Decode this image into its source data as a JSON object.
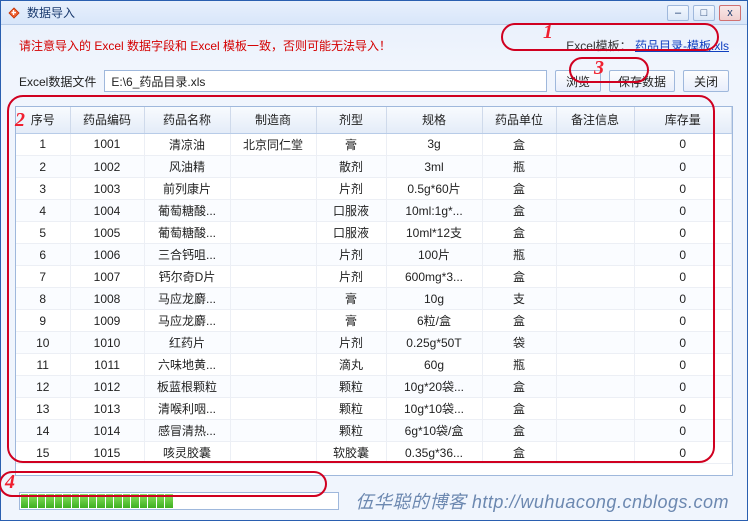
{
  "window": {
    "title": "数据导入"
  },
  "warning": "请注意导入的 Excel 数据字段和 Excel 模板一致，否则可能无法导入！",
  "template": {
    "label": "Excel模板：",
    "link_text": "药品目录-模板.xls"
  },
  "file": {
    "label": "Excel数据文件",
    "value": "E:\\6_药品目录.xls",
    "browse_label": "浏览",
    "save_label": "保存数据",
    "close_label": "关闭"
  },
  "columns": [
    "序号",
    "药品编码",
    "药品名称",
    "制造商",
    "剂型",
    "规格",
    "药品单位",
    "备注信息",
    "库存量"
  ],
  "rows": [
    {
      "seq": "1",
      "code": "1001",
      "name": "清凉油",
      "mfr": "北京同仁堂",
      "form": "膏",
      "spec": "3g",
      "unit": "盒",
      "remark": "",
      "stock": "0"
    },
    {
      "seq": "2",
      "code": "1002",
      "name": "风油精",
      "mfr": "",
      "form": "散剂",
      "spec": "3ml",
      "unit": "瓶",
      "remark": "",
      "stock": "0"
    },
    {
      "seq": "3",
      "code": "1003",
      "name": "前列康片",
      "mfr": "",
      "form": "片剂",
      "spec": "0.5g*60片",
      "unit": "盒",
      "remark": "",
      "stock": "0"
    },
    {
      "seq": "4",
      "code": "1004",
      "name": "葡萄糖酸...",
      "mfr": "",
      "form": "口服液",
      "spec": "10ml:1g*...",
      "unit": "盒",
      "remark": "",
      "stock": "0"
    },
    {
      "seq": "5",
      "code": "1005",
      "name": "葡萄糖酸...",
      "mfr": "",
      "form": "口服液",
      "spec": "10ml*12支",
      "unit": "盒",
      "remark": "",
      "stock": "0"
    },
    {
      "seq": "6",
      "code": "1006",
      "name": "三合钙咀...",
      "mfr": "",
      "form": "片剂",
      "spec": "100片",
      "unit": "瓶",
      "remark": "",
      "stock": "0"
    },
    {
      "seq": "7",
      "code": "1007",
      "name": "钙尔奇D片",
      "mfr": "",
      "form": "片剂",
      "spec": "600mg*3...",
      "unit": "盒",
      "remark": "",
      "stock": "0"
    },
    {
      "seq": "8",
      "code": "1008",
      "name": "马应龙麝...",
      "mfr": "",
      "form": "膏",
      "spec": "10g",
      "unit": "支",
      "remark": "",
      "stock": "0"
    },
    {
      "seq": "9",
      "code": "1009",
      "name": "马应龙麝...",
      "mfr": "",
      "form": "膏",
      "spec": "6粒/盒",
      "unit": "盒",
      "remark": "",
      "stock": "0"
    },
    {
      "seq": "10",
      "code": "1010",
      "name": "红药片",
      "mfr": "",
      "form": "片剂",
      "spec": "0.25g*50T",
      "unit": "袋",
      "remark": "",
      "stock": "0"
    },
    {
      "seq": "11",
      "code": "1011",
      "name": "六味地黄...",
      "mfr": "",
      "form": "滴丸",
      "spec": "60g",
      "unit": "瓶",
      "remark": "",
      "stock": "0"
    },
    {
      "seq": "12",
      "code": "1012",
      "name": "板蓝根颗粒",
      "mfr": "",
      "form": "颗粒",
      "spec": "10g*20袋...",
      "unit": "盒",
      "remark": "",
      "stock": "0"
    },
    {
      "seq": "13",
      "code": "1013",
      "name": "清喉利咽...",
      "mfr": "",
      "form": "颗粒",
      "spec": "10g*10袋...",
      "unit": "盒",
      "remark": "",
      "stock": "0"
    },
    {
      "seq": "14",
      "code": "1014",
      "name": "感冒清热...",
      "mfr": "",
      "form": "颗粒",
      "spec": "6g*10袋/盒",
      "unit": "盒",
      "remark": "",
      "stock": "0"
    },
    {
      "seq": "15",
      "code": "1015",
      "name": "咳灵胶囊",
      "mfr": "",
      "form": "软胶囊",
      "spec": "0.35g*36...",
      "unit": "盒",
      "remark": "",
      "stock": "0"
    }
  ],
  "watermark": "伍华聪的博客 http://wuhuacong.cnblogs.com",
  "annotations": {
    "1": "1",
    "2": "2",
    "3": "3",
    "4": "4"
  }
}
